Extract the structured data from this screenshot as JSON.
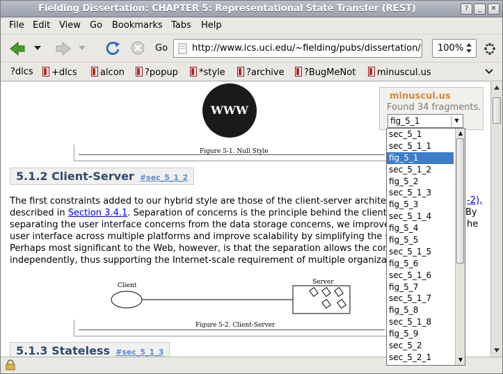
{
  "window": {
    "title": "Fielding Dissertation: CHAPTER 5: Representational State Transfer (REST)"
  },
  "menu": [
    "File",
    "Edit",
    "View",
    "Go",
    "Bookmarks",
    "Tabs",
    "Help"
  ],
  "nav": {
    "go_label": "Go",
    "url": "http://www.ics.uci.edu/~fielding/pubs/dissertation/rest_arch_style.htm",
    "zoom": "100%"
  },
  "bookmarks": [
    "?dlcs",
    "+dlcs",
    "alcon",
    "?popup",
    "*style",
    "?archive",
    "?BugMeNot",
    "minuscul.us"
  ],
  "content": {
    "www_label": "WWW",
    "fig1_caption": "Figure 5-1. Null Style",
    "sec512": {
      "title": "5.1.2 Client-Server",
      "anchor": "#sec_5_1_2"
    },
    "para_lines": [
      "The first constraints added to our hybrid style are those of the client-server architectu",
      "described in ",
      ". Separation of concerns is the principle behind the client-se",
      "separating the user interface concerns from the data storage concerns, we improve t",
      "user interface across multiple platforms and improve scalability by simplifying the ser",
      "Perhaps most significant to the Web, however, is that the separation allows the comp",
      "independently, thus supporting the Internet-scale requirement of multiple organizatio"
    ],
    "para_link": "Section 3.4.1",
    "frag_right_1": "-2),",
    "frag_right_2": "By",
    "frag_right_3": "he",
    "client_label": "Client",
    "server_label": "Server",
    "fig2_caption": "Figure 5-2. Client-Server",
    "sec513": {
      "title": "5.1.3 Stateless",
      "anchor": "#sec_5_1_3"
    }
  },
  "popup": {
    "title": "minuscul.us",
    "status": "Found 34 fragments.",
    "selected": "fig_5_1",
    "items": [
      "sec_5_1",
      "sec_5_1_1",
      "fig_5_1",
      "sec_5_1_2",
      "fig_5_2",
      "sec_5_1_3",
      "fig_5_3",
      "sec_5_1_4",
      "fig_5_4",
      "fig_5_5",
      "sec_5_1_5",
      "fig_5_6",
      "sec_5_1_6",
      "fig_5_7",
      "sec_5_1_7",
      "fig_5_8",
      "sec_5_1_8",
      "fig_5_9",
      "sec_5_2",
      "sec_5_2_1"
    ]
  }
}
